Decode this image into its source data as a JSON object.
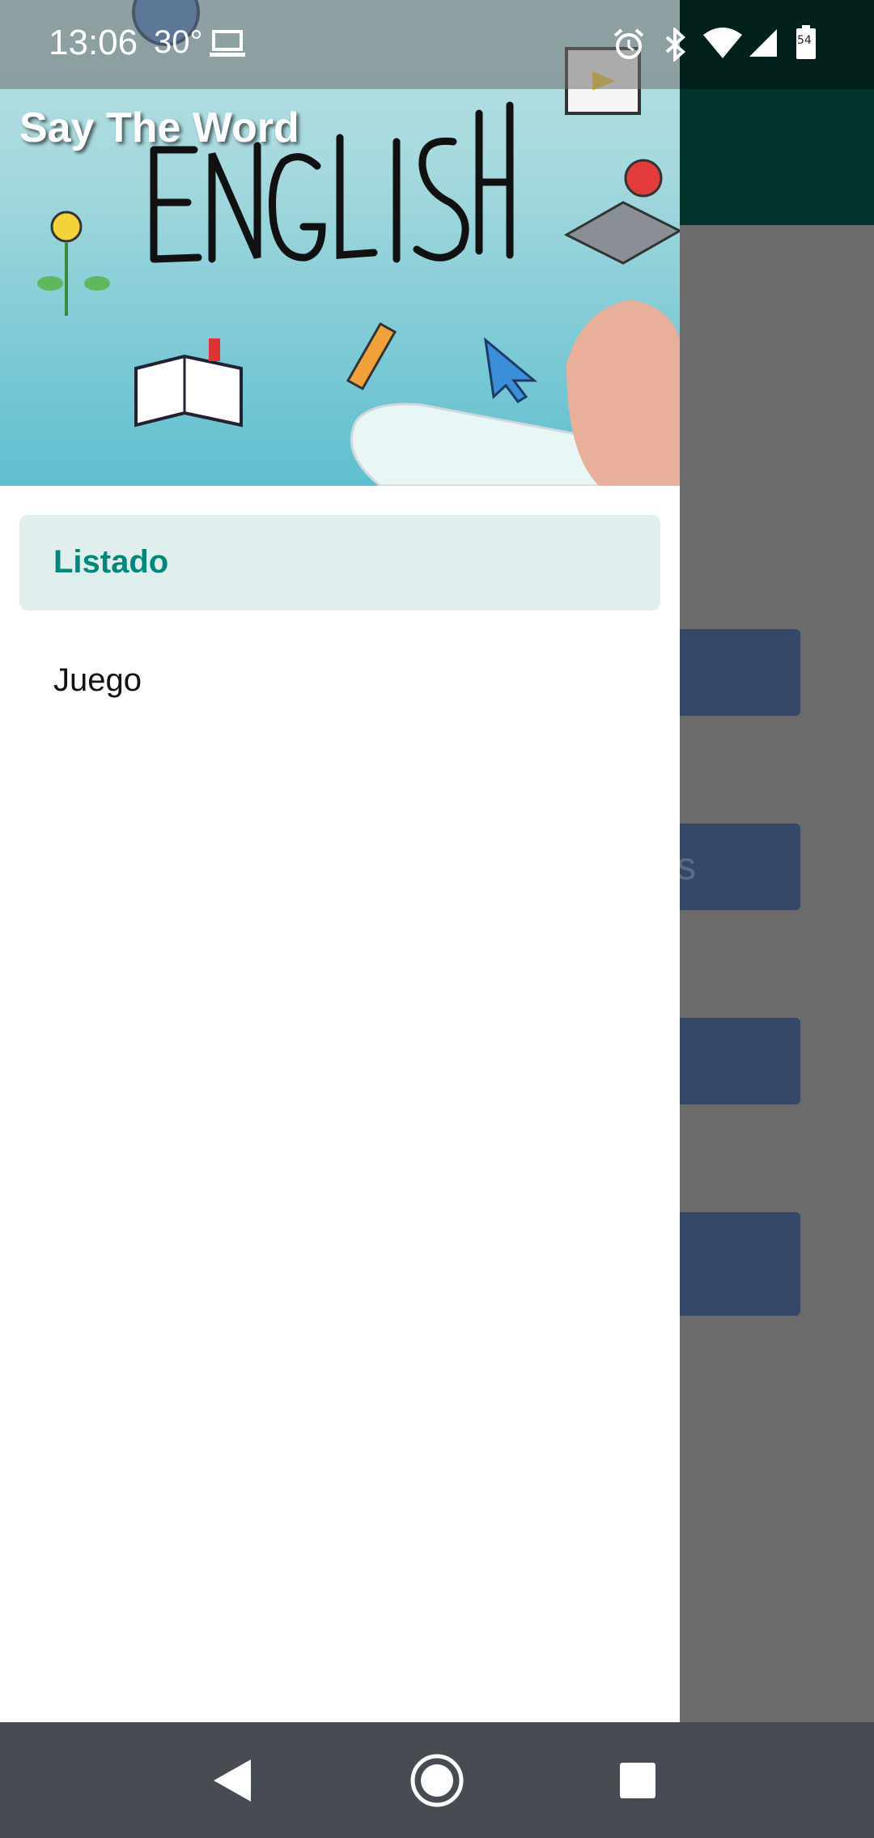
{
  "status_bar": {
    "time": "13:06",
    "temperature": "30°",
    "battery_level": "54",
    "icons": [
      "laptop-icon",
      "alarm-icon",
      "bluetooth-icon",
      "wifi-icon",
      "signal-icon",
      "battery-icon"
    ]
  },
  "drawer": {
    "header_title": "Say The Word",
    "menu_items": [
      {
        "label": "Listado",
        "active": true
      },
      {
        "label": "Juego",
        "active": false
      }
    ]
  },
  "background": {
    "partial_button_text": "s"
  },
  "colors": {
    "accent": "#00897b",
    "active_item_bg": "#e0efed",
    "toolbar": "#02342c",
    "button": "#36486a",
    "nav_bar": "#464c52"
  },
  "nav_bar": {
    "icons": [
      "back-icon",
      "home-icon",
      "recents-icon"
    ]
  }
}
